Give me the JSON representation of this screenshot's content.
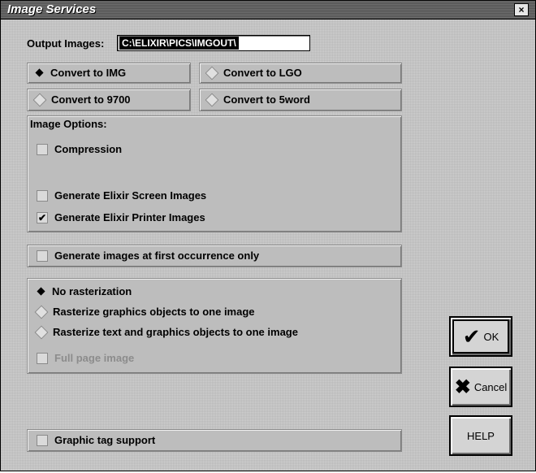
{
  "window": {
    "title": "Image Services",
    "close_label": "×"
  },
  "output": {
    "label": "Output Images:",
    "path": "C:\\ELIXIR\\PICS\\IMGOUT\\"
  },
  "convert": {
    "img": "Convert to IMG",
    "lgo": "Convert to LGO",
    "v9700": "Convert to 9700",
    "sword": "Convert to 5word",
    "selected": "img"
  },
  "image_options": {
    "heading": "Image Options:",
    "compression": {
      "label": "Compression",
      "checked": false
    },
    "screen": {
      "label": "Generate Elixir Screen Images",
      "checked": false
    },
    "printer": {
      "label": "Generate Elixir Printer Images",
      "checked": true
    }
  },
  "first_occurrence": {
    "label": "Generate images at first occurrence only",
    "checked": false
  },
  "raster": {
    "none": "No rasterization",
    "graphics": "Rasterize graphics objects to one image",
    "text_graphics": "Rasterize text and graphics objects to one image",
    "full_page": "Full page image",
    "selected": "none"
  },
  "graphic_tag": {
    "label": "Graphic tag support",
    "checked": false
  },
  "buttons": {
    "ok": "OK",
    "cancel": "Cancel",
    "help": "HELP"
  },
  "check_glyph": "✔"
}
